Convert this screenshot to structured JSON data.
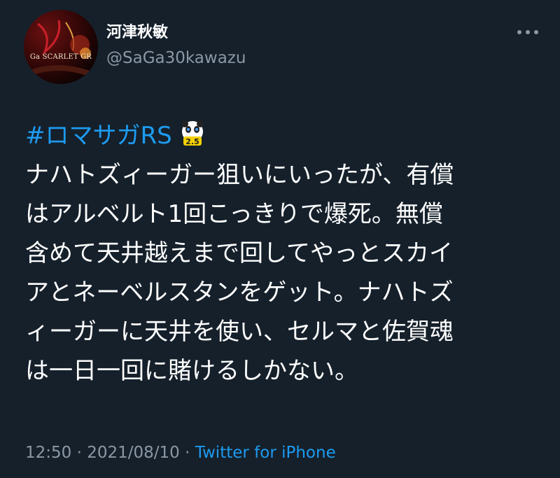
{
  "author": {
    "display_name": "河津秋敏",
    "handle": "@SaGa30kawazu",
    "avatar_caption": "Ga SCARLET GR"
  },
  "tweet": {
    "hashtag": "#ロマサガRS",
    "emoji_label": "2.5",
    "lines": [
      "ナハトズィーガー狙いにいったが、有償",
      "はアルベルト1回こっきりで爆死。無償",
      "含めて天井越えまで回してやっとスカイ",
      "アとネーベルスタンをゲット。ナハトズ",
      "ィーガーに天井を使い、セルマと佐賀魂",
      "は一日一回に賭けるしかない。"
    ]
  },
  "meta": {
    "time": "12:50",
    "separator": "·",
    "date": "2021/08/10",
    "source": "Twitter for iPhone"
  },
  "colors": {
    "background": "#15202b",
    "link": "#1d9bf0",
    "secondary_text": "#8b98a5"
  },
  "icons": {
    "more": "more-horizontal-icon",
    "emoji": "panda-face-emoji-icon"
  }
}
